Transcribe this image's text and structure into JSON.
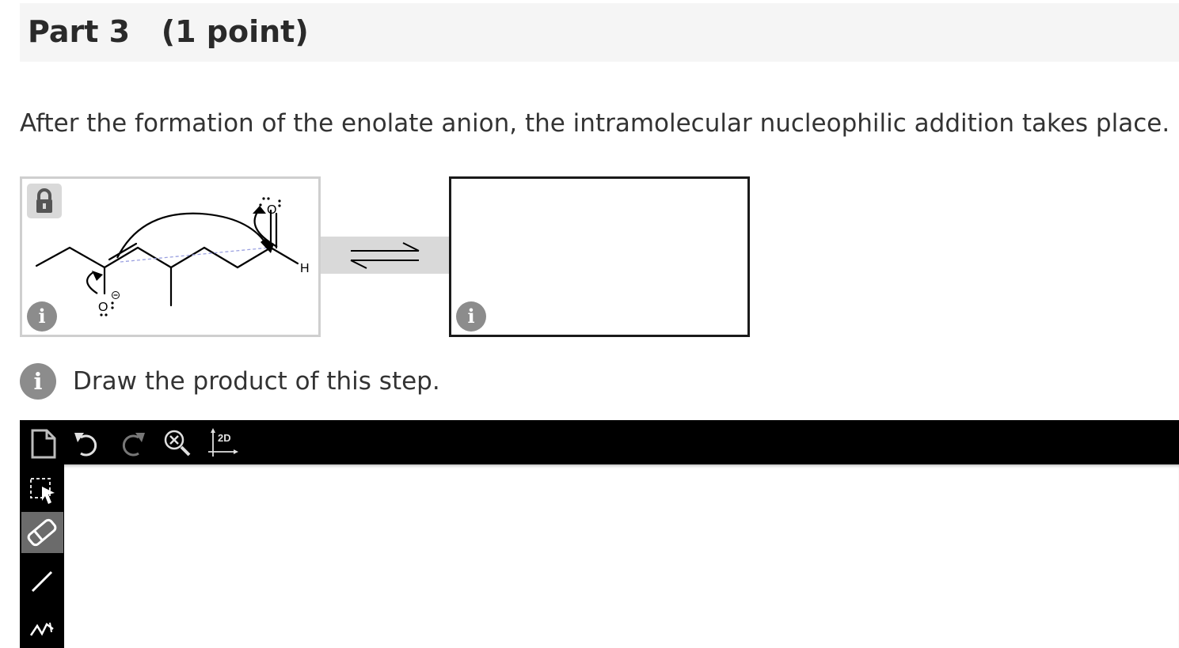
{
  "part": {
    "title": "Part 3   (1 point)"
  },
  "prompt": "After the formation of the enolate anion, the intramolecular nucleophilic addition takes place.",
  "molecule": {
    "atoms": {
      "hydrogen": "H",
      "oxygen_top": "O",
      "oxygen_bottom": "O"
    }
  },
  "instruction": "Draw the product of this step.",
  "info_symbol": "i",
  "toolbar": {
    "dimension_label": "2D"
  },
  "icons": {
    "lock": "lock-icon",
    "info": "info-icon",
    "new_document": "new-document-icon",
    "undo": "undo-icon",
    "redo": "redo-icon",
    "zoom_reset": "zoom-reset-icon",
    "clean_2d": "clean-2d-icon",
    "select": "rectangle-select-icon",
    "erase": "eraser-icon",
    "bond": "single-bond-icon",
    "chain": "chain-icon"
  },
  "colors": {
    "toolbar": "#000000",
    "active_tool": "#6b6b6b",
    "info": "#8c8c8c"
  }
}
